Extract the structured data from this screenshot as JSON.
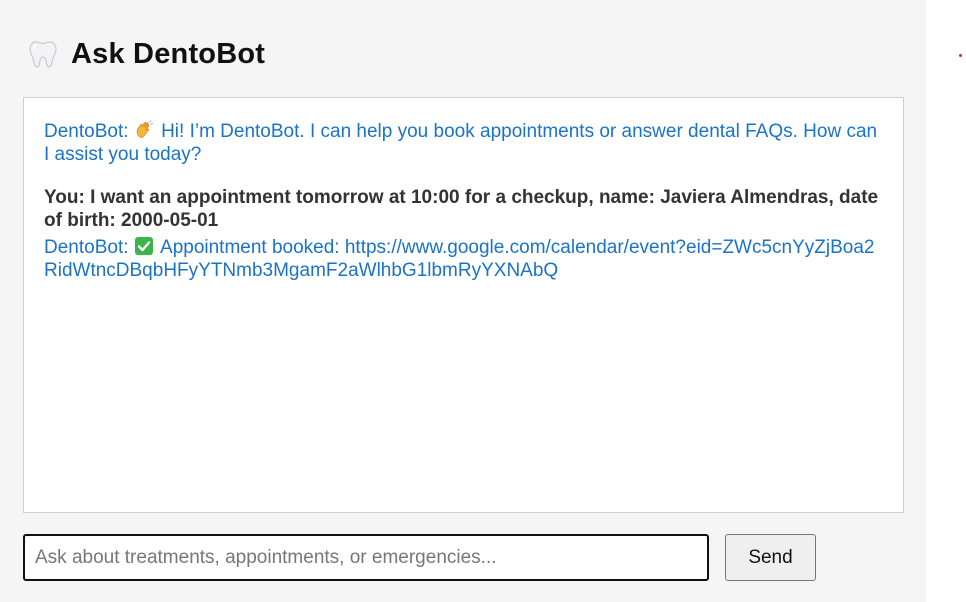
{
  "header": {
    "icon": "tooth-icon",
    "title": "Ask DentoBot"
  },
  "chat": {
    "messages": [
      {
        "role": "bot",
        "prefix": "DentoBot:",
        "icon": "waving-hand-icon",
        "text": "Hi! I’m DentoBot. I can help you book appointments or answer dental FAQs. How can I assist you today?"
      },
      {
        "role": "user",
        "prefix": "You:",
        "text": "I want an appointment tomorrow at 10:00 for a checkup, name: Javiera Almendras, date of birth: 2000-05-01"
      },
      {
        "role": "bot",
        "prefix": "DentoBot:",
        "icon": "check-mark-icon",
        "text": "Appointment booked: https://www.google.com/calendar/event?eid=ZWc5cnYyZjBoa2RidWtncDBqbHFyYTNmb3MgamF2aWlhbG1lbmRyYXNAbQ"
      }
    ]
  },
  "composer": {
    "placeholder": "Ask about treatments, appointments, or emergencies...",
    "value": "",
    "send_label": "Send"
  },
  "colors": {
    "bot_text": "#1a73c8",
    "user_text": "#333333",
    "panel_bg": "#f5f5f5",
    "check_green": "#3cb44a"
  }
}
